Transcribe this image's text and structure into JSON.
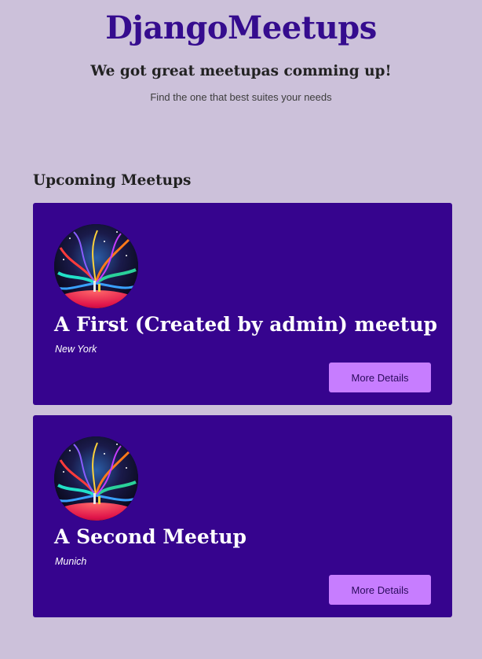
{
  "header": {
    "title": "DjangoMeetups",
    "tagline": "We got great meetupas comming up!",
    "subtext": "Find the one that best suites your needs"
  },
  "section": {
    "title": "Upcoming Meetups"
  },
  "meetups": [
    {
      "title": "A First (Created by admin) meetup",
      "location": "New York",
      "button_label": "More Details",
      "image_icon": "cosmic-scene-image"
    },
    {
      "title": "A Second Meetup",
      "location": "Munich",
      "button_label": "More Details",
      "image_icon": "cosmic-scene-image"
    }
  ],
  "colors": {
    "background": "#ccc1da",
    "brand": "#350c8e",
    "card": "#36048e",
    "button": "#c77dff"
  }
}
